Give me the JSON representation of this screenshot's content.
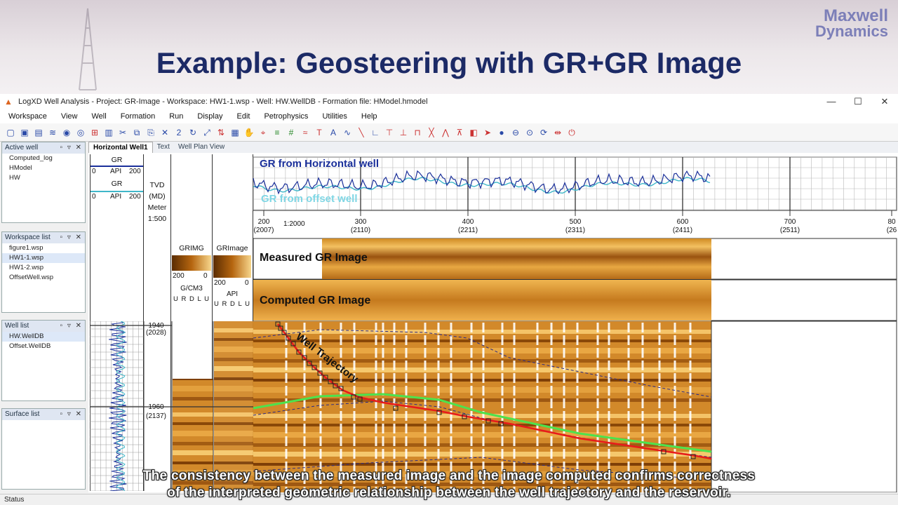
{
  "slide": {
    "title": "Example: Geosteering with GR+GR Image",
    "brand_line1": "Maxwell",
    "brand_line2": "Dynamics"
  },
  "window": {
    "title": "LogXD Well Analysis - Project: GR-Image - Workspace: HW1-1.wsp - Well: HW.WellDB - Formation file: HModel.hmodel",
    "controls": [
      "—",
      "☐",
      "✕"
    ]
  },
  "menu": [
    "Workspace",
    "View",
    "Well",
    "Formation",
    "Run",
    "Display",
    "Edit",
    "Petrophysics",
    "Utilities",
    "Help"
  ],
  "panels": {
    "active_well": {
      "title": "Active well",
      "items": [
        "Computed_log",
        "HModel",
        "HW"
      ]
    },
    "workspace_list": {
      "title": "Workspace list",
      "items": [
        "figure1.wsp",
        "HW1-1.wsp",
        "HW1-2.wsp",
        "OffsetWell.wsp"
      ],
      "selected": "HW1-1.wsp"
    },
    "well_list": {
      "title": "Well list",
      "items": [
        "HW.WellDB",
        "Offset.WellDB"
      ],
      "selected": "HW.WellDB"
    },
    "surface_list": {
      "title": "Surface list",
      "items": []
    }
  },
  "tabs": [
    "Horizontal Well1",
    "Text",
    "Well Plan View"
  ],
  "tracks": {
    "gr_curve1": {
      "name": "GR",
      "min": "0",
      "unit": "API",
      "max": "200"
    },
    "gr_curve2": {
      "name": "GR",
      "min": "0",
      "unit": "API",
      "max": "200"
    },
    "depth": {
      "l1": "TVD",
      "l2": "(MD)",
      "l3": "Meter",
      "l4": "1:500"
    },
    "grimg": {
      "name": "GRIMG",
      "min": "200",
      "max": "0",
      "unit": "G/CM3",
      "dirs": "U R D L U"
    },
    "grimage": {
      "name": "GRImage",
      "min": "200",
      "max": "0",
      "unit": "API",
      "dirs": "U R D L U"
    },
    "depth_marks": [
      {
        "tvd": "1940",
        "md": "(2028)"
      },
      {
        "tvd": "1960",
        "md": "(2137)"
      }
    ]
  },
  "section": {
    "gr_title_horizontal": "GR from Horizontal well",
    "gr_title_offset": "GR from offset well",
    "scale": "1:2000",
    "x_ticks": [
      {
        "v": "200",
        "md": "(2007)"
      },
      {
        "v": "300",
        "md": "(2110)"
      },
      {
        "v": "400",
        "md": "(2211)"
      },
      {
        "v": "500",
        "md": "(2311)"
      },
      {
        "v": "600",
        "md": "(2411)"
      },
      {
        "v": "700",
        "md": "(2511)"
      },
      {
        "v": "80",
        "md": "(26"
      }
    ],
    "measured_label": "Measured GR Image",
    "computed_label": "Computed GR Image",
    "trajectory_label": "Well Trajectory"
  },
  "status": "Status",
  "caption": {
    "line1": "The consistency between the measured image and the image computed confirms correctness",
    "line2": "of the interpreted geometric relationship between the well trajectory and the reservoir."
  },
  "colors": {
    "title": "#1c2a66",
    "gr_horizontal": "#1a2f9a",
    "gr_offset": "#3fb7c9",
    "image_dark": "#7a3f05",
    "image_light": "#f5c56a",
    "trajectory": "#e81b1b",
    "green_horizon": "#4de24d"
  }
}
